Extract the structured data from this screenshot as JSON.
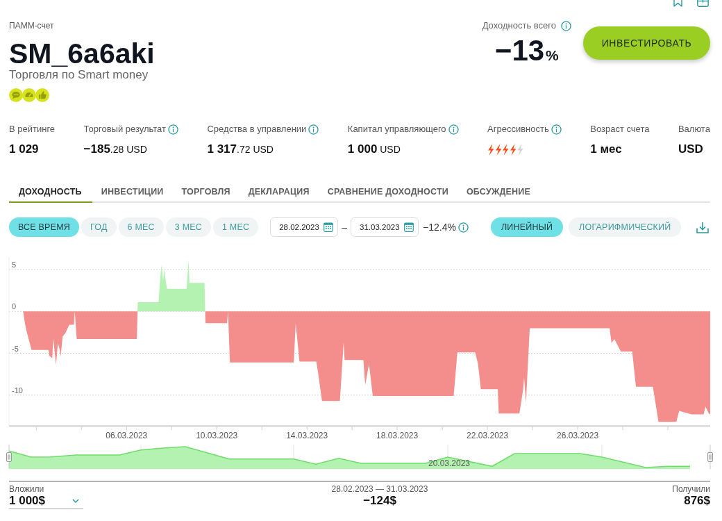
{
  "account": {
    "type_label": "ПАММ-счет",
    "name": "SM_6a6aki",
    "strategy": "Торговля по Smart money"
  },
  "total_return": {
    "label": "Доходность всего",
    "info": true,
    "value": "−13",
    "unit": "%"
  },
  "invest_button": "ИНВЕСТИРОВАТЬ",
  "stats": [
    {
      "label": "В рейтинге",
      "info": false,
      "kind": "plain",
      "value": "1 029"
    },
    {
      "label": "Торговый результат",
      "info": true,
      "kind": "amount",
      "value": "**−185**.28 USD"
    },
    {
      "label": "Средства в управлении",
      "info": true,
      "kind": "amount",
      "value": "**1 317**.72 USD"
    },
    {
      "label": "Капитал управляющего",
      "info": true,
      "kind": "amount",
      "value": "**1 000** USD"
    },
    {
      "label": "Агрессивность",
      "info": true,
      "kind": "rating",
      "stars": 4
    },
    {
      "label": "Возраст счета",
      "info": false,
      "kind": "plain",
      "value": "1 мес"
    },
    {
      "label": "Валюта",
      "info": false,
      "kind": "plain",
      "value": "USD"
    }
  ],
  "tabs": [
    {
      "label": "ДОХОДНОСТЬ",
      "selected": true
    },
    {
      "label": "ИНВЕСТИЦИИ",
      "selected": false
    },
    {
      "label": "ТОРГОВЛЯ",
      "selected": false
    },
    {
      "label": "ДЕКЛАРАЦИЯ",
      "selected": false
    },
    {
      "label": "СРАВНЕНИЕ ДОХОДНОСТИ",
      "selected": false
    },
    {
      "label": "ОБСУЖДЕНИЕ",
      "selected": false
    }
  ],
  "periods": [
    {
      "label": "ВСЕ ВРЕМЯ",
      "selected": true
    },
    {
      "label": "ГОД",
      "selected": false
    },
    {
      "label": "6 МЕС",
      "selected": false
    },
    {
      "label": "3 МЕС",
      "selected": false
    },
    {
      "label": "1 МЕС",
      "selected": false
    }
  ],
  "date_range": {
    "from": "28.02.2023",
    "separator": "–",
    "to": "31.03.2023",
    "change": "−12.4%",
    "info": true
  },
  "scales": [
    {
      "label": "ЛИНЕЙНЫЙ",
      "selected": true
    },
    {
      "label": "ЛОГАРИФМИЧЕСКИЙ",
      "selected": false
    }
  ],
  "chart": {
    "chart_data": [
      {
        "type": "area",
        "x": [
          "2023-02-28T19:00",
          "2023-03-01T10:00",
          "2023-03-01T12:00",
          "2023-03-01T14:00",
          "2023-03-01T19:00",
          "2023-03-02T13:00",
          "2023-03-02T14:00",
          "2023-03-02T17:00",
          "2023-03-02T18:00",
          "2023-03-02T21:00",
          "2023-03-02T23:00",
          "2023-03-03T01:00",
          "2023-03-03T02:00",
          "2023-03-03T04:00",
          "2023-03-03T07:00",
          "2023-03-03T11:00",
          "2023-03-03T16:00",
          "2023-03-03T17:00",
          "2023-03-03T19:00",
          "2023-03-06T11:00",
          "2023-03-06T11:45",
          "2023-03-06T12:00",
          "2023-03-07T10:00",
          "2023-03-07T13:00",
          "2023-03-07T15:00",
          "2023-03-07T16:00",
          "2023-03-07T19:00",
          "2023-03-08T16:00",
          "2023-03-08T18:00",
          "2023-03-08T19:00",
          "2023-03-09T11:00",
          "2023-03-09T11:40",
          "2023-03-09T12:00",
          "2023-03-10T11:00",
          "2023-03-10T12:00",
          "2023-03-10T14:00",
          "2023-03-13T10:00",
          "2023-03-13T12:00",
          "2023-03-13T16:00",
          "2023-03-14T10:00",
          "2023-03-14T12:00",
          "2023-03-14T16:00",
          "2023-03-15T11:00",
          "2023-03-15T15:00",
          "2023-03-15T16:00",
          "2023-03-16T12:00",
          "2023-03-16T14:00",
          "2023-03-16T18:00",
          "2023-03-16T22:00",
          "2023-03-20T12:00",
          "2023-03-20T14:00",
          "2023-03-20T16:00",
          "2023-03-21T11:00",
          "2023-03-21T14:00",
          "2023-03-21T17:00",
          "2023-03-22T11:00",
          "2023-03-22T12:00",
          "2023-03-23T10:00",
          "2023-03-23T14:00",
          "2023-03-23T15:00",
          "2023-03-23T17:00",
          "2023-03-23T21:00",
          "2023-03-27T10:00",
          "2023-03-27T12:00",
          "2023-03-27T15:00",
          "2023-03-27T22:00",
          "2023-03-28T10:00",
          "2023-03-28T14:00",
          "2023-03-29T08:00",
          "2023-03-29T14:00",
          "2023-03-30T09:00",
          "2023-03-30T12:00",
          "2023-03-31T01:00",
          "2023-03-31T14:00",
          "2023-03-31T16:00",
          "2023-03-31T20:00",
          "2023-03-31T21:00"
        ],
        "series": [
          {
            "color": "#f48e8c",
            "values": [
              0,
              0,
              -1.5,
              -2.5,
              -4.6,
              -4.6,
              -5.3,
              -5.6,
              -3.2,
              -6.4,
              -3.8,
              -4.6,
              -5.4,
              -3,
              -2.6,
              -1.6,
              -1.6,
              0,
              -3.3,
              -3.3,
              0,
              null,
              null,
              null,
              null,
              null,
              null,
              null,
              null,
              null,
              null,
              0,
              -1.4,
              -1.4,
              0,
              -6.1,
              -6.1,
              -1.4,
              -6,
              -6,
              -7.5,
              -10.7,
              -10.7,
              -3.7,
              -5.8,
              -5.8,
              -8.8,
              -6.3,
              -10.1,
              -10.1,
              -7.6,
              -4.9,
              -4.9,
              -6.3,
              -9.3,
              -9.3,
              -12.2,
              -12.2,
              -9.3,
              -7.9,
              -10.9,
              -2,
              -2,
              -3.8,
              -3.3,
              -4.8,
              -4.8,
              -9,
              -9,
              -13.2,
              -13.2,
              -11.9,
              -12.3,
              -12.3,
              -11.4,
              -12.3,
              -12.2
            ]
          },
          {
            "color": "#b3f2b0",
            "values": [
              null,
              null,
              null,
              null,
              null,
              null,
              null,
              null,
              null,
              null,
              null,
              null,
              null,
              null,
              null,
              null,
              null,
              null,
              null,
              null,
              0,
              1.1,
              1.1,
              5.5,
              3.7,
              5,
              2.7,
              2.7,
              6.1,
              3.4,
              3.4,
              0,
              null,
              null,
              null,
              null,
              null,
              null,
              null,
              null,
              null,
              null,
              null,
              null,
              null,
              null,
              null,
              null,
              null,
              null,
              null,
              null,
              null,
              null,
              null,
              null,
              null,
              null,
              null,
              null,
              null,
              null,
              null,
              null,
              null,
              null,
              null,
              null,
              null,
              null,
              null,
              null,
              null,
              null,
              null,
              null,
              null
            ]
          }
        ],
        "xlim": [
          "2023-02-28T19:00",
          "2023-03-31T21:00"
        ],
        "ylim": [
          -13.7,
          6.5
        ],
        "yticks": [
          -10,
          -5,
          0,
          5
        ],
        "xticks": [
          {
            "value": "2023-03-06",
            "label": "06.03.2023"
          },
          {
            "value": "2023-03-10",
            "label": "10.03.2023"
          },
          {
            "value": "2023-03-14",
            "label": "14.03.2023"
          },
          {
            "value": "2023-03-18",
            "label": "18.03.2023"
          },
          {
            "value": "2023-03-22",
            "label": "22.03.2023"
          },
          {
            "value": "2023-03-26",
            "label": "26.03.2023"
          }
        ],
        "grid": true
      }
    ],
    "navigator": {
      "label": "20.03.2023"
    }
  },
  "footer": {
    "invested": {
      "label": "Вложили",
      "value": "1 000$"
    },
    "period": {
      "label": "28.02.2023 — 31.03.2023",
      "value": "−124$"
    },
    "received": {
      "label": "Получили",
      "value": "876$"
    }
  }
}
